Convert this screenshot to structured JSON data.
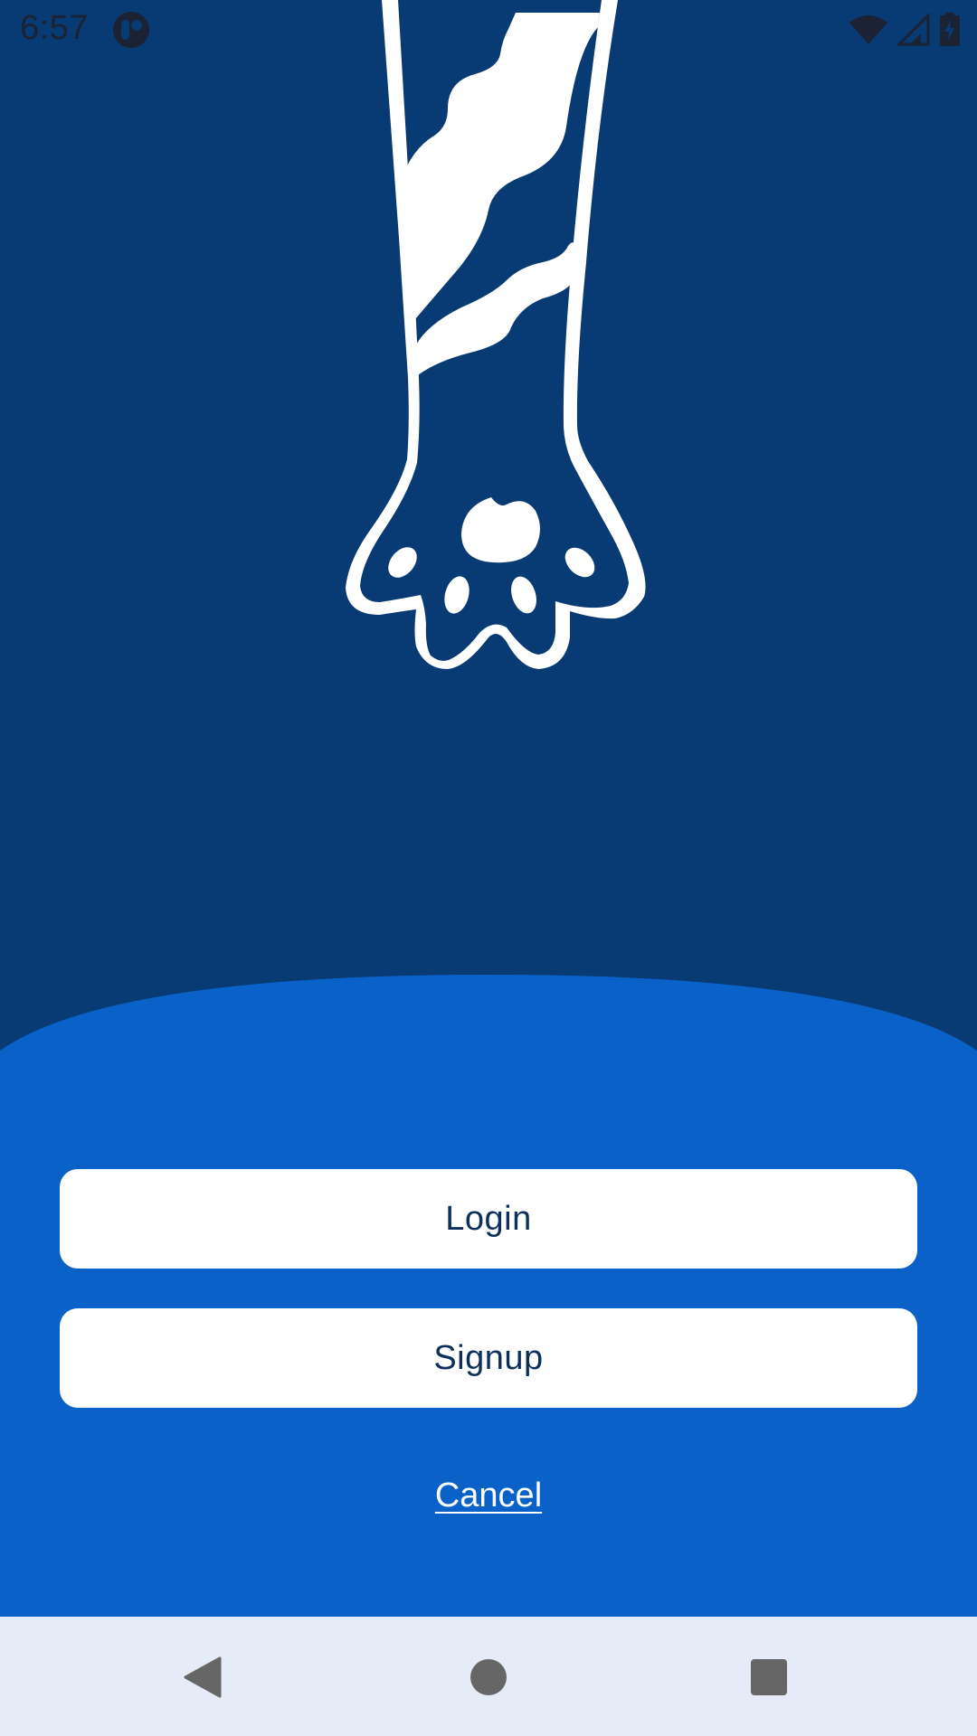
{
  "status_bar": {
    "time": "6:57",
    "icons": [
      "app-notification-icon",
      "wifi-icon",
      "cellular-signal-icon",
      "battery-charging-icon"
    ]
  },
  "hero": {
    "illustration": "cat-paw-arm-illustration"
  },
  "actions": {
    "login_label": "Login",
    "signup_label": "Signup",
    "cancel_label": "Cancel"
  },
  "navigation_bar": {
    "icons": [
      "back-icon",
      "home-icon",
      "recents-icon"
    ]
  },
  "colors": {
    "background_dark": "#083a74",
    "sheet_blue": "#0a62c9",
    "button_background": "#ffffff",
    "button_text": "#0d2f5c",
    "nav_bar": "#e6ecf7",
    "nav_icons": "#666666"
  }
}
